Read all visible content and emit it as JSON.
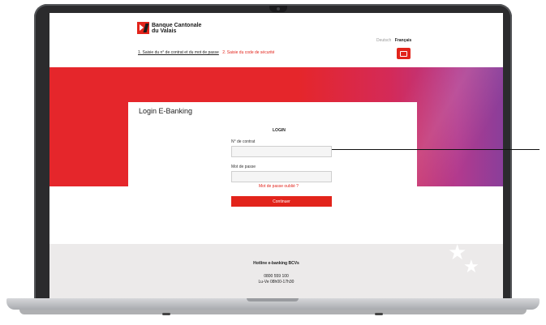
{
  "bank": {
    "name_line1": "Banque Cantonale",
    "name_line2": "du Valais"
  },
  "steps": {
    "step1": "1. Saisie du n° de contrat et du mot de passe",
    "step2": "2. Saisie du code de sécurité"
  },
  "languages": {
    "de": "Deutsch",
    "fr": "Français"
  },
  "login": {
    "title": "Login E-Banking",
    "section": "LOGIN",
    "contract_label": "N° de contrat",
    "contract_value": "",
    "password_label": "Mot de passe",
    "password_value": "",
    "forgot": "Mot de passe oublié ?",
    "continue": "Continuer"
  },
  "footer": {
    "hotline": "Hotline e-banking BCVs",
    "phone": "0800 559 100",
    "hours": "Lu-Ve 08h00-17h30"
  },
  "colors": {
    "brand": "#e2241b",
    "footer_bg": "#eceaea"
  },
  "icons": {
    "chat": "chat-bubble-icon",
    "logo": "bcvs-logo-icon",
    "decor": "star-icon"
  }
}
